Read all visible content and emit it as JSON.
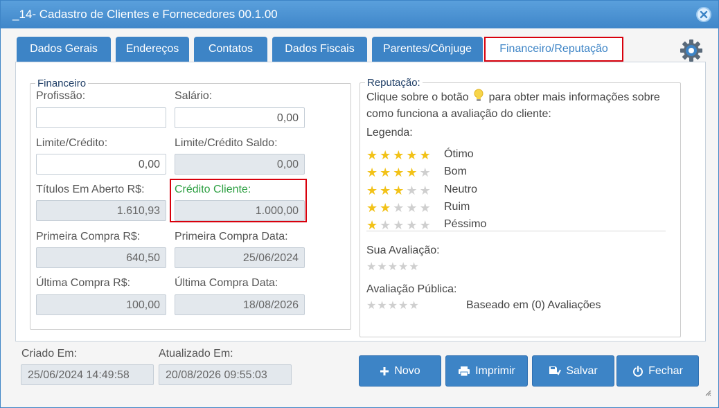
{
  "window": {
    "title": "_14- Cadastro de Clientes e Fornecedores 00.1.00"
  },
  "tabs": [
    {
      "label": "Dados Gerais"
    },
    {
      "label": "Endereços"
    },
    {
      "label": "Contatos"
    },
    {
      "label": "Dados Fiscais"
    },
    {
      "label": "Parentes/Cônjuge"
    },
    {
      "label": "Financeiro/Reputação",
      "active": true
    }
  ],
  "financeiro": {
    "legend": "Financeiro",
    "profissao": {
      "label": "Profissão:",
      "value": ""
    },
    "salario": {
      "label": "Salário:",
      "value": "0,00"
    },
    "limite_credito": {
      "label": "Limite/Crédito:",
      "value": "0,00"
    },
    "limite_credito_saldo": {
      "label": "Limite/Crédito Saldo:",
      "value": "0,00"
    },
    "titulos_aberto": {
      "label": "Títulos Em Aberto R$:",
      "value": "1.610,93"
    },
    "credito_cliente": {
      "label": "Crédito Cliente:",
      "value": "1.000,00"
    },
    "primeira_compra": {
      "label": "Primeira Compra R$:",
      "value": "640,50"
    },
    "primeira_compra_data": {
      "label": "Primeira Compra Data:",
      "value": "25/06/2024"
    },
    "ultima_compra": {
      "label": "Última Compra R$:",
      "value": "100,00"
    },
    "ultima_compra_data": {
      "label": "Última Compra Data:",
      "value": "18/08/2026"
    }
  },
  "reputacao": {
    "legend": "Reputação:",
    "intro_before": "Clique sobre o botão",
    "intro_after": "para obter mais informações sobre",
    "intro_line2": "como funciona a avaliação do cliente:",
    "legenda_label": "Legenda:",
    "levels": [
      {
        "label": "Ótimo",
        "stars": 5
      },
      {
        "label": "Bom",
        "stars": 4
      },
      {
        "label": "Neutro",
        "stars": 3
      },
      {
        "label": "Ruim",
        "stars": 2
      },
      {
        "label": "Péssimo",
        "stars": 1
      }
    ],
    "sua_avaliacao_label": "Sua Avaliação:",
    "sua_avaliacao_stars": 0,
    "avaliacao_publica_label": "Avaliação Pública:",
    "avaliacao_publica_stars": 0,
    "avaliacao_publica_text": "Baseado em (0) Avaliações"
  },
  "footer": {
    "criado_label": "Criado Em:",
    "criado_value": "25/06/2024 14:49:58",
    "atualizado_label": "Atualizado Em:",
    "atualizado_value": "20/08/2026 09:55:03"
  },
  "buttons": {
    "novo": "Novo",
    "imprimir": "Imprimir",
    "salvar": "Salvar",
    "fechar": "Fechar"
  },
  "colors": {
    "primary": "#3d84c6",
    "highlight": "#d8000c",
    "star_on": "#f2c218",
    "star_off": "#cfcfcf",
    "credit_label": "#2ea043"
  }
}
